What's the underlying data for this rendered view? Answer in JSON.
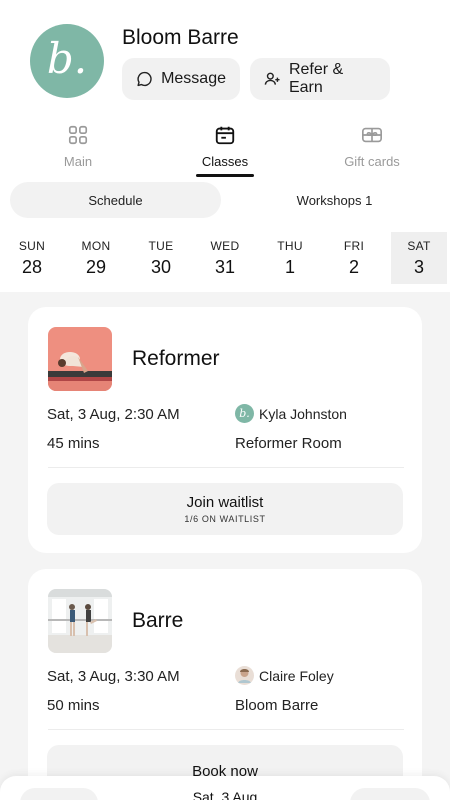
{
  "studio": {
    "name": "Bloom Barre",
    "logo_letter": "b."
  },
  "header_buttons": {
    "message": "Message",
    "refer": "Refer & Earn"
  },
  "tabs": [
    {
      "label": "Main",
      "icon": "grid-icon",
      "active": false
    },
    {
      "label": "Classes",
      "icon": "calendar-icon",
      "active": true
    },
    {
      "label": "Gift cards",
      "icon": "gift-card-icon",
      "active": false
    }
  ],
  "segments": {
    "schedule": "Schedule",
    "workshops": "Workshops 1"
  },
  "week": [
    {
      "day": "SUN",
      "date": "28"
    },
    {
      "day": "MON",
      "date": "29"
    },
    {
      "day": "TUE",
      "date": "30"
    },
    {
      "day": "WED",
      "date": "31"
    },
    {
      "day": "THU",
      "date": "1"
    },
    {
      "day": "FRI",
      "date": "2"
    },
    {
      "day": "SAT",
      "date": "3",
      "selected": true
    }
  ],
  "classes": [
    {
      "name": "Reformer",
      "datetime": "Sat, 3 Aug, 2:30 AM",
      "duration": "45 mins",
      "instructor": "Kyla Johnston",
      "room": "Reformer Room",
      "action_label": "Join waitlist",
      "action_sub": "1/6 ON WAITLIST"
    },
    {
      "name": "Barre",
      "datetime": "Sat, 3 Aug, 3:30 AM",
      "duration": "50 mins",
      "instructor": "Claire Foley",
      "room": "Bloom Barre",
      "action_label": "Book now"
    }
  ],
  "bottom_bar": {
    "date": "Sat, 3 Aug"
  },
  "colors": {
    "brand": "#7fb7a6",
    "background": "#f4f4f4",
    "button": "#f2f2f2"
  }
}
